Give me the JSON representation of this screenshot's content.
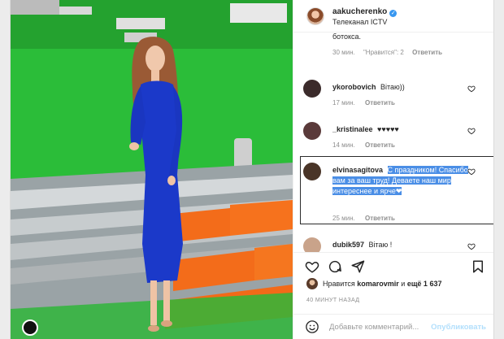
{
  "post": {
    "author": {
      "username": "aakucherenko",
      "subtitle": "Телеканал ICTV",
      "verified_mark": "✓"
    },
    "photo_alt_icon": "tv-studio-photo"
  },
  "comments": {
    "partial_tail": {
      "text": "ботокса.",
      "time": "30 мин.",
      "likes": "\"Нравится\": 2",
      "reply": "Ответить"
    },
    "items": [
      {
        "username": "ykorobovich",
        "text": "Вітаю))",
        "time": "17 мин.",
        "reply": "Ответить",
        "avatar_color": "#3b2b2b"
      },
      {
        "username": "_kristinalee",
        "text": "♥♥♥♥♥",
        "time": "14 мин.",
        "reply": "Ответить",
        "avatar_color": "#5a3a3a"
      },
      {
        "username": "elvinasagitova",
        "text": "С праздником! Спасибо вам за ваш труд! Деваете наш мир интереснее и ярче❤",
        "time": "25 мин.",
        "reply": "Ответить",
        "avatar_color": "#4a3528"
      },
      {
        "username": "dubik597",
        "text": "Вітаю !",
        "time": "",
        "reply": "",
        "avatar_color": "#c9a38a"
      }
    ]
  },
  "likes": {
    "prefix": "Нравится",
    "user": "komarovmir",
    "suffix": "и",
    "count": "ещё 1 637"
  },
  "timestamp": "40 МИНУТ НАЗАД",
  "add_comment": {
    "placeholder": "Добавьте комментарий...",
    "publish": "Опубликовать"
  },
  "colors": {
    "accent": "#3897f0",
    "selection": "#4a8ee6",
    "publish_disabled": "#b2dffc"
  }
}
